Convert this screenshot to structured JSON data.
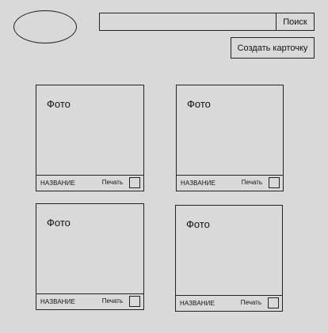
{
  "search": {
    "value": "",
    "placeholder": "",
    "button_label": "Поиск"
  },
  "create_card": {
    "label": "Создать карточку"
  },
  "cards": [
    {
      "photo_label": "Фото",
      "title": "НАЗВАНИЕ",
      "print_label": "Печать"
    },
    {
      "photo_label": "Фото",
      "title": "НАЗВАНИЕ",
      "print_label": "Печать"
    },
    {
      "photo_label": "Фото",
      "title": "НАЗВАНИЕ",
      "print_label": "Печать"
    },
    {
      "photo_label": "Фото",
      "title": "НАЗВАНИЕ",
      "print_label": "Печать"
    }
  ]
}
